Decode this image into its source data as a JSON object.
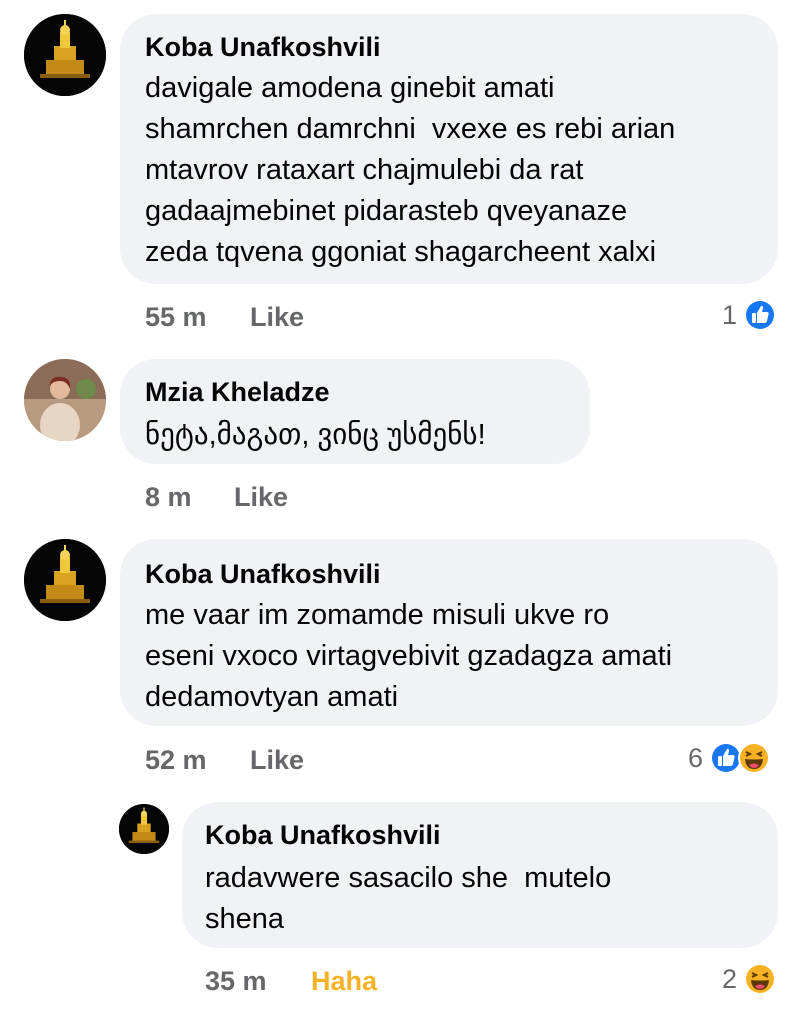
{
  "comments": [
    {
      "author": "Koba Unafkoshvili",
      "lines": [
        "davigale amodena ginebit amati",
        "shamrchen damrchni  vxexe es rebi arian",
        "mtavrov rataxart chajmulebi da rat",
        "gadaajmebinet pidarasteb qveyanaze",
        "zeda tqvena ggoniat shagarcheent xalxi"
      ],
      "time": "55 m",
      "action": "Like",
      "reaction_count": "1",
      "reactions": [
        "like-icon"
      ]
    },
    {
      "author": "Mzia Kheladze",
      "lines": [
        "ნეტა,მაგათ, ვინც უსმენს!"
      ],
      "time": "8 m",
      "action": "Like"
    },
    {
      "author": "Koba Unafkoshvili",
      "lines": [
        "me vaar im zomamde misuli ukve ro",
        "eseni vxoco virtagvebivit gzadagza amati",
        "dedamovtyan amati"
      ],
      "time": "52 m",
      "action": "Like",
      "reaction_count": "6",
      "reactions": [
        "like-icon",
        "haha-icon"
      ]
    },
    {
      "author": "Koba Unafkoshvili",
      "lines": [
        "radavwere sasacilo she  mutelo",
        "shena"
      ],
      "time": "35 m",
      "action": "Haha",
      "reaction_count": "2",
      "reactions": [
        "haha-icon"
      ]
    }
  ],
  "colors": {
    "bubble": "#f0f2f5",
    "meta": "#65676b",
    "like_blue": "#1877f2",
    "haha_yellow": "#f7b125"
  }
}
